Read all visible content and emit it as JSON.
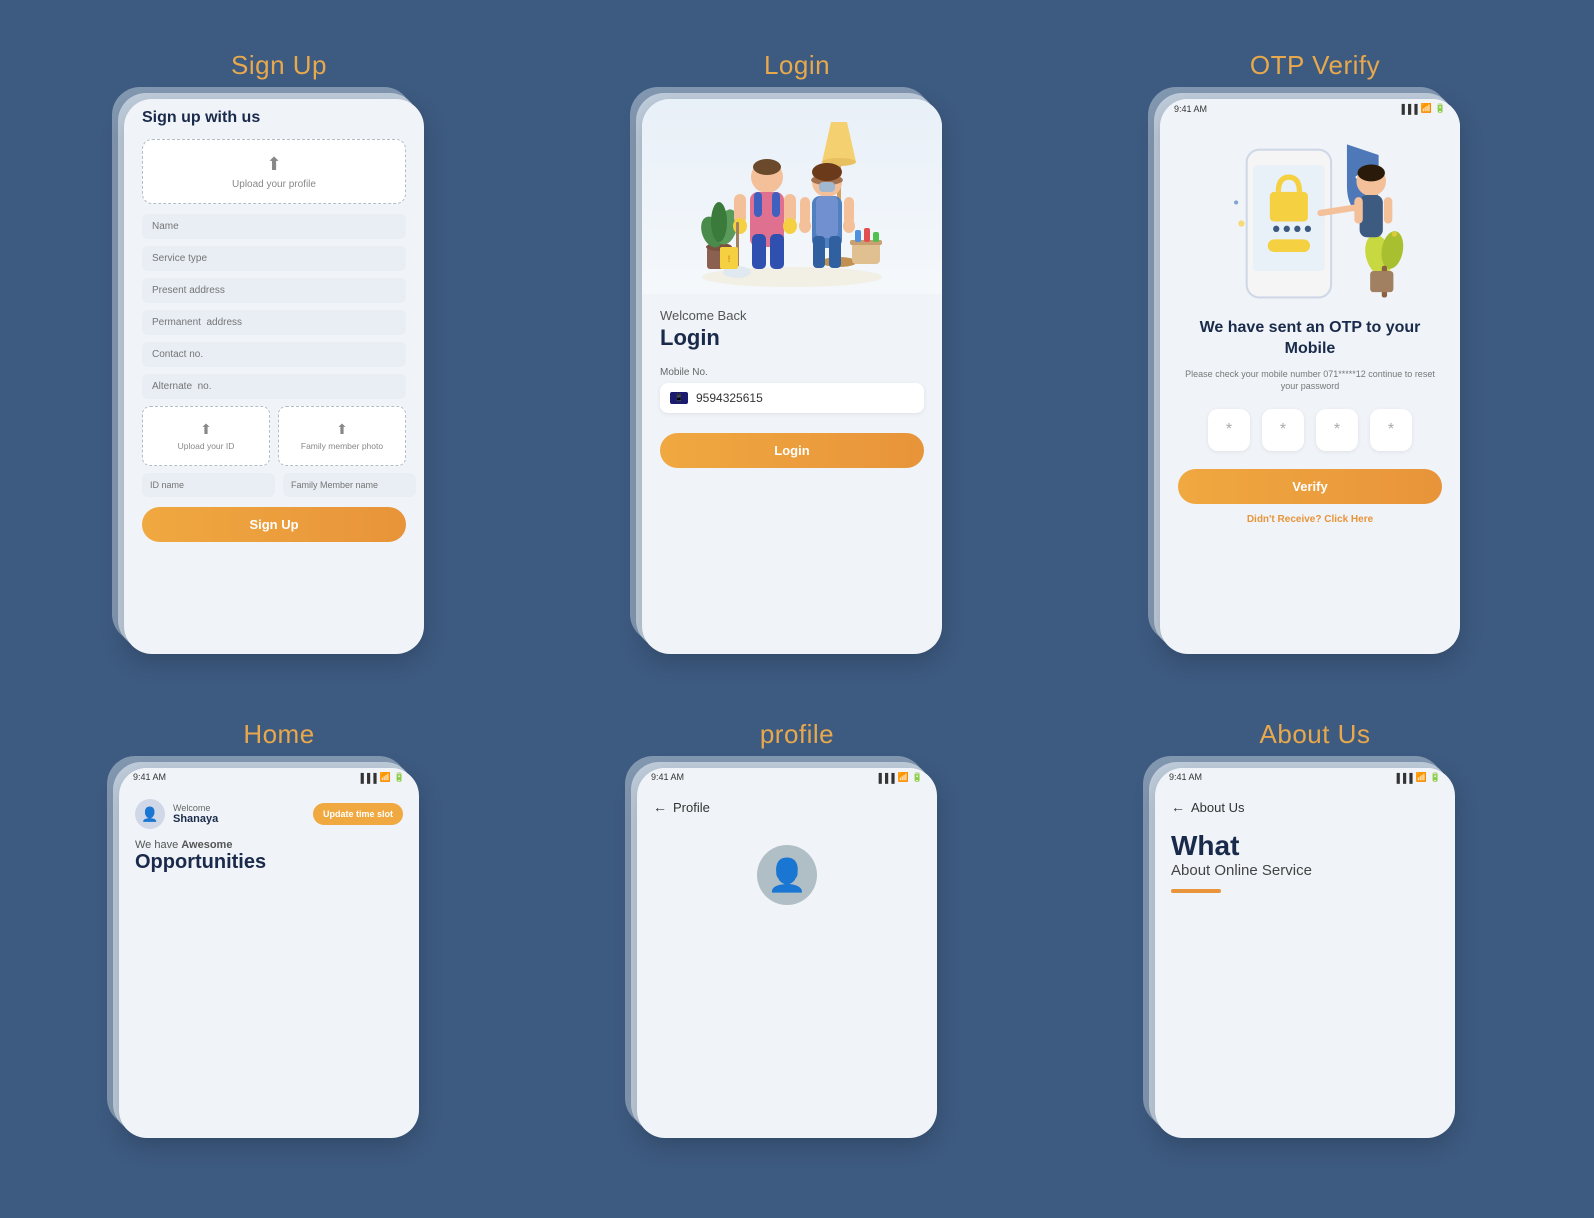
{
  "sections": {
    "signup": {
      "title": "Sign Up",
      "screen": {
        "heading": "Sign up with us",
        "upload_profile_label": "Upload your  profile",
        "fields": [
          {
            "placeholder": "Name"
          },
          {
            "placeholder": "Service type"
          },
          {
            "placeholder": "Present address"
          },
          {
            "placeholder": "Permanent  address"
          },
          {
            "placeholder": "Contact no."
          },
          {
            "placeholder": "Alternate  no."
          }
        ],
        "upload_id_label": "Upload your ID",
        "family_photo_label": "Family member photo",
        "id_name_placeholder": "ID name",
        "family_member_placeholder": "Family Member name",
        "button_label": "Sign Up"
      }
    },
    "login": {
      "title": "Login",
      "screen": {
        "welcome": "Welcome Back",
        "heading": "Login",
        "mobile_label": "Mobile No.",
        "mobile_value": "9594325615",
        "button_label": "Login"
      }
    },
    "otp": {
      "title": "OTP Verify",
      "screen": {
        "heading": "We have sent an OTP to your Mobile",
        "subtext": "Please check your mobile number 071*****12 continue to reset your password",
        "otp_placeholders": [
          "*",
          "*",
          "*",
          "*"
        ],
        "button_label": "Verify",
        "resend_prefix": "Didn't Receive?",
        "resend_link": "Click Here"
      }
    },
    "home": {
      "title": "Home",
      "screen": {
        "time": "9:41 AM",
        "welcome_label": "Welcome",
        "user_name": "Shanaya",
        "update_button": "Update time slot",
        "opp_pre": "We have",
        "opp_bold": "Awesome",
        "opp_title": "Opportunities"
      }
    },
    "profile": {
      "title": "profile",
      "screen": {
        "time": "9:41 AM",
        "back_label": "Profile"
      }
    },
    "about": {
      "title": "About Us",
      "screen": {
        "time": "9:41 AM",
        "back_label": "About Us",
        "title_big": "What",
        "subtitle": "About Online Service"
      }
    }
  },
  "status_bar": {
    "time": "9:41 AM",
    "signal": "▐▐▐",
    "wifi": "WiFi",
    "battery": "🔋"
  },
  "colors": {
    "orange": "#e8943a",
    "dark_blue": "#1a2a4a",
    "bg_blue": "#3d5a80",
    "light_bg": "#f0f4f8"
  }
}
